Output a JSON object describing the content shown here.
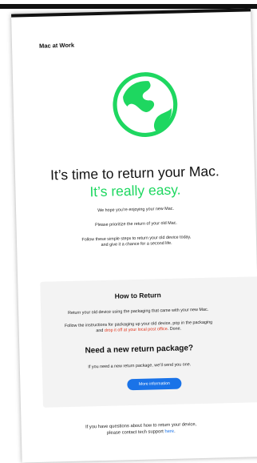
{
  "brand": "Mac at Work",
  "hero": {
    "title": "It’s time to return your Mac.",
    "subtitle": "It’s really easy."
  },
  "intro": {
    "line1": "We hope you’re enjoying your new Mac.",
    "line2": "Please prioritize the return of your old Mac.",
    "line3a": "Follow these simple steps to return your old device today,",
    "line3b": "and give it a chance for a second life."
  },
  "how_to_return": {
    "title": "How to Return",
    "line1": "Return your old device using the packaging that came with your new Mac.",
    "line2a": "Follow the instructions for packaging up your old device, pop in the packaging",
    "line2b_prefix": "and ",
    "line2b_link": "drop it off at your local post office",
    "line2b_suffix": ". Done."
  },
  "new_package": {
    "title": "Need a new return package?",
    "text": "If you need a new return package, we’ll send you one.",
    "button_label": "More information"
  },
  "footer": {
    "line1": "If you have questions about how to return your device,",
    "line2_prefix": "please contact tech support ",
    "link": "here",
    "line2_suffix": "."
  },
  "colors": {
    "accent_green": "#1ed760",
    "link_red": "#e0341c",
    "button_blue": "#1a73e8",
    "stripe": "#111111"
  },
  "icons": {
    "hero_icon": "globe-icon"
  }
}
